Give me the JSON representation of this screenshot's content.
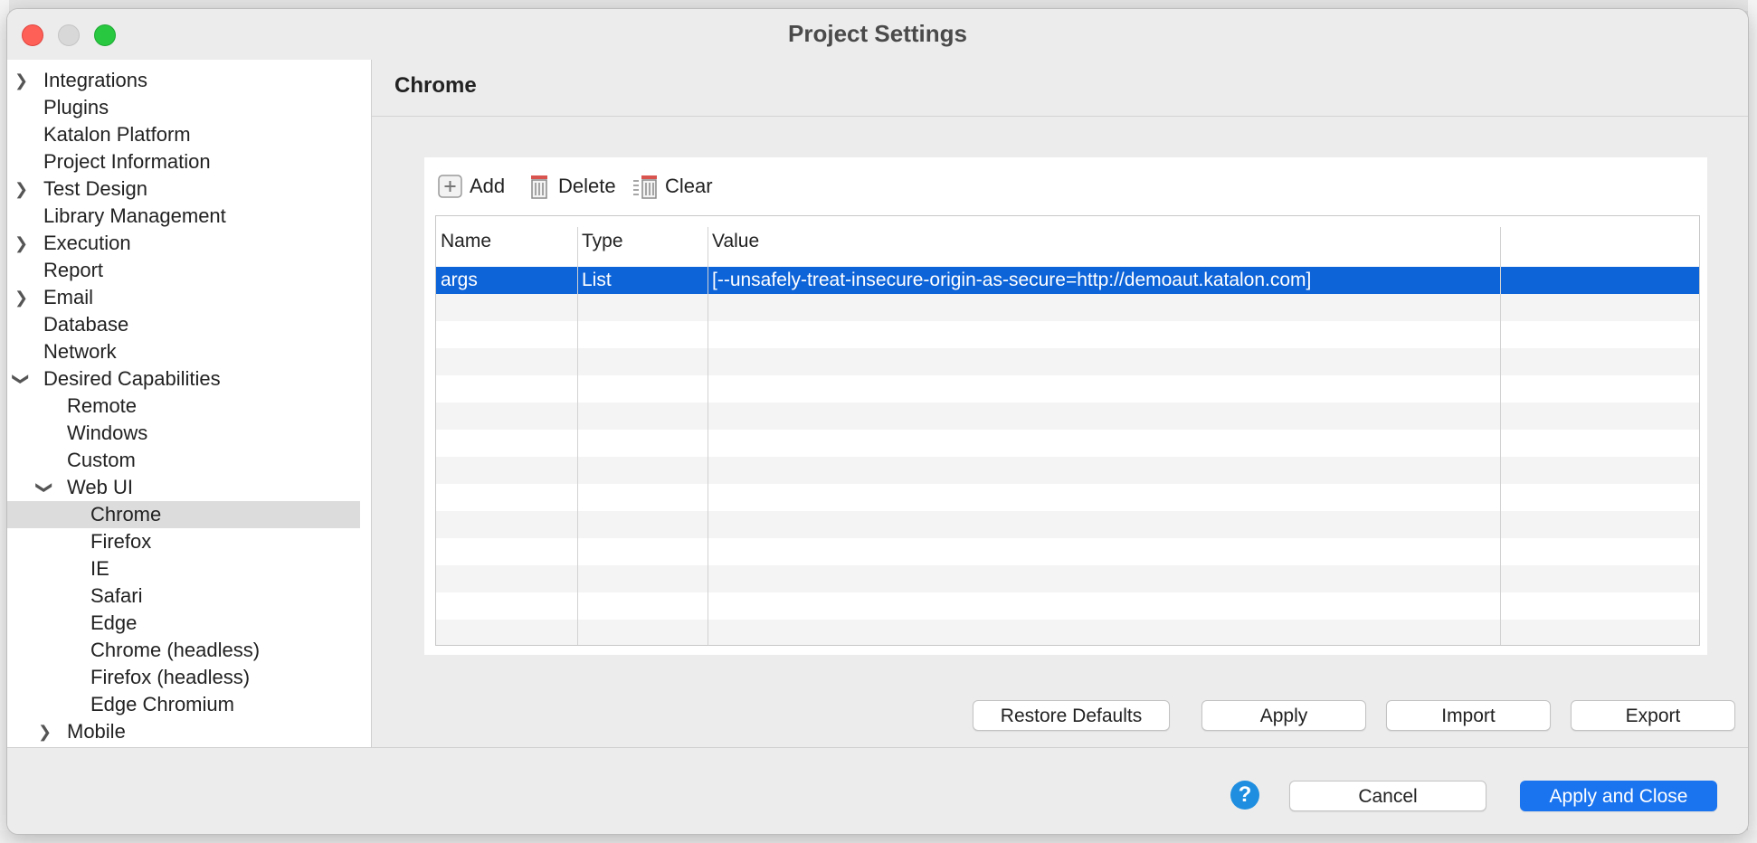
{
  "window": {
    "title": "Project Settings"
  },
  "sidebar": {
    "items": [
      {
        "label": "Integrations",
        "expander": "collapsed"
      },
      {
        "label": "Plugins"
      },
      {
        "label": "Katalon Platform"
      },
      {
        "label": "Project Information"
      },
      {
        "label": "Test Design",
        "expander": "collapsed"
      },
      {
        "label": "Library Management"
      },
      {
        "label": "Execution",
        "expander": "collapsed"
      },
      {
        "label": "Report"
      },
      {
        "label": "Email",
        "expander": "collapsed"
      },
      {
        "label": "Database"
      },
      {
        "label": "Network"
      },
      {
        "label": "Desired Capabilities",
        "expander": "expanded"
      },
      {
        "label": "Remote"
      },
      {
        "label": "Windows"
      },
      {
        "label": "Custom"
      },
      {
        "label": "Web UI",
        "expander": "expanded"
      },
      {
        "label": "Chrome",
        "selected": true
      },
      {
        "label": "Firefox"
      },
      {
        "label": "IE"
      },
      {
        "label": "Safari"
      },
      {
        "label": "Edge"
      },
      {
        "label": "Chrome (headless)"
      },
      {
        "label": "Firefox (headless)"
      },
      {
        "label": "Edge Chromium"
      },
      {
        "label": "Mobile",
        "expander": "collapsed"
      }
    ]
  },
  "main": {
    "title": "Chrome",
    "toolbar": {
      "add": "Add",
      "delete": "Delete",
      "clear": "Clear"
    },
    "table": {
      "columns": [
        "Name",
        "Type",
        "Value"
      ],
      "rows": [
        {
          "name": "args",
          "type": "List",
          "value": "[--unsafely-treat-insecure-origin-as-secure=http://demoaut.katalon.com]",
          "selected": true
        }
      ]
    },
    "buttons": {
      "restore": "Restore Defaults",
      "apply": "Apply",
      "import": "Import",
      "export": "Export"
    }
  },
  "footer": {
    "help": "?",
    "cancel": "Cancel",
    "apply_close": "Apply and Close"
  },
  "colors": {
    "selection": "#0d63d8",
    "primary_button": "#1a74f0",
    "help_icon": "#1f8ee0"
  }
}
